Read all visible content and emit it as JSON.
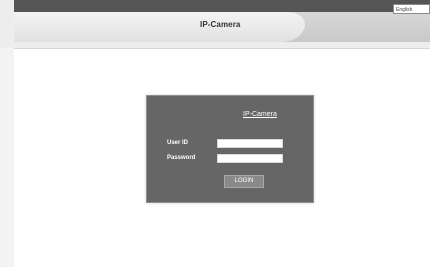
{
  "header": {
    "title": "IP-Camera",
    "language_selected": "English"
  },
  "login": {
    "title": "IP-Camera",
    "user_id_label": "User ID",
    "password_label": "Password",
    "user_id_value": "",
    "password_value": "",
    "button_label": "LOGIN"
  },
  "colors": {
    "panel_background": "#666666",
    "page_background": "#ffffff",
    "header_background": "#ededed"
  }
}
